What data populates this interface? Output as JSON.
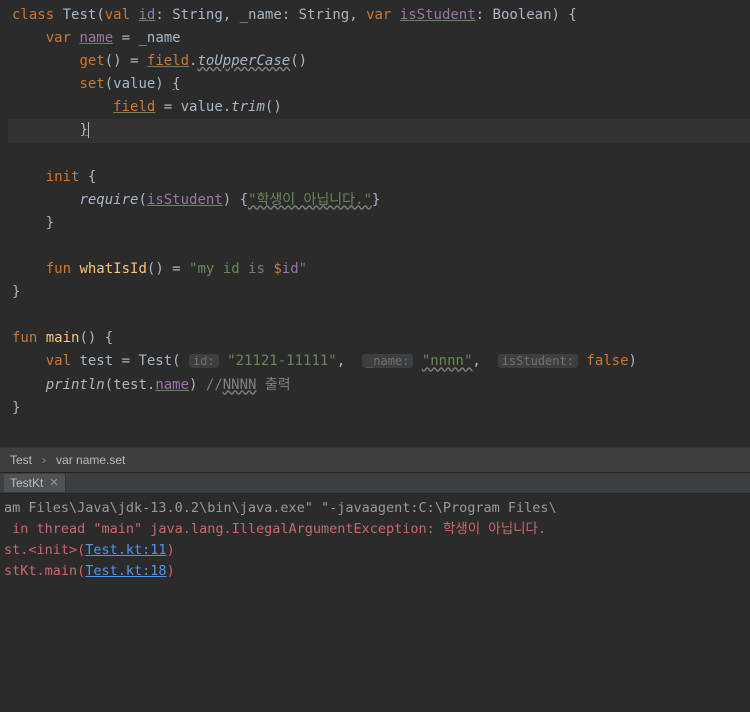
{
  "code": {
    "l1_class": "class",
    "l1_name": "Test",
    "l1_paren_open": "(",
    "l1_val": "val",
    "l1_id": "id",
    "l1_col": ": String, _name: String, ",
    "l1_var": "var",
    "l1_isstudent": "isStudent",
    "l1_tail": ": Boolean) {",
    "l2_var": "var",
    "l2_name": "name",
    "l2_eq": " = _name",
    "l3_get": "get",
    "l3_paren": "() = ",
    "l3_field": "field",
    "l3_dot": ".",
    "l3_upper": "toUpperCase",
    "l3_tail": "()",
    "l4_set": "set",
    "l4_value": "(value) ",
    "l4_brace": "{",
    "l5_field": "field",
    "l5_eq": " = value.",
    "l5_trim": "trim",
    "l5_tail": "()",
    "l6_brace": "}",
    "l8_init": "init",
    "l8_brace": " {",
    "l9_require": "require",
    "l9_p1": "(",
    "l9_isstudent": "isStudent",
    "l9_p2": ") {",
    "l9_str": "\"학생이 아닙니다.\"",
    "l9_tail": "}",
    "l10_brace": "}",
    "l12_fun": "fun",
    "l12_name": "whatIsId",
    "l12_paren": "() = ",
    "l12_str_a": "\"my id is ",
    "l12_dollar": "$",
    "l12_id": "id",
    "l12_str_b": "\"",
    "l13_brace": "}",
    "l15_fun": "fun",
    "l15_main": "main",
    "l15_tail": "() {",
    "l16_val": "val",
    "l16_test": " test = Test( ",
    "l16_h1": "id:",
    "l16_s1": "\"21121-11111\"",
    "l16_c1": ",  ",
    "l16_h2": "_name:",
    "l16_s2": "\"nnnn\"",
    "l16_c2": ",  ",
    "l16_h3": "isStudent:",
    "l16_false": "false",
    "l16_tail": ")",
    "l17_println": "println",
    "l17_p": "(test.",
    "l17_name": "name",
    "l17_close": ") ",
    "l17_c": "//",
    "l17_nnnn": "NNNN",
    "l17_out": " 출력",
    "l18_brace": "}"
  },
  "breadcrumb": {
    "a": "Test",
    "b": "var name.set"
  },
  "tab": {
    "label": "TestKt"
  },
  "console": {
    "l1a": "am Files\\Java\\jdk-13.0.2\\bin\\java.exe\" \"-javaagent:C:\\Program Files\\",
    "l2": " in thread \"main\" java.lang.IllegalArgumentException: 학생이 아닙니다.",
    "l3a": "st.<init>(",
    "l3link": "Test.kt:11",
    "l3b": ")",
    "l4a": "stKt.main(",
    "l4link": "Test.kt:18",
    "l4b": ")"
  }
}
